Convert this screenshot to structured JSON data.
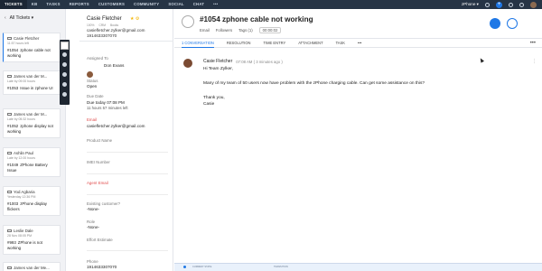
{
  "nav": {
    "tabs": [
      "TICKETS",
      "KB",
      "TASKS",
      "REPORTS",
      "CUSTOMERS",
      "COMMUNITY",
      "SOCIAL",
      "CHAT",
      "•••"
    ],
    "department": "zPhone ▾"
  },
  "list": {
    "view_label": "All Tickets ▾",
    "cards": [
      {
        "name": "Casie Fletcher",
        "meta": "11:57 hours left",
        "number": "#1054",
        "subject": "zphone cable not working"
      },
      {
        "name": "James van der M...",
        "meta": "Late by 09:00 hours",
        "number": "#1053",
        "subject": "Issue in zphone UI"
      },
      {
        "name": "James van der M...",
        "meta": "Late by 05:32 hours",
        "number": "#1052",
        "subject": "zphone display not working"
      },
      {
        "name": "Ashlin Paul",
        "meta": "Late by 12:00 hours",
        "number": "#1049",
        "subject": "ZPhone Battery Issue"
      },
      {
        "name": "Yod Agbaria",
        "meta": "Yesterday 12:36 PM",
        "number": "#1003",
        "subject": "zPhone display flickers"
      },
      {
        "name": "Leslie Dale",
        "meta": "28 Nov 08:05 PM",
        "number": "#993",
        "subject": "ZPhone is not working"
      },
      {
        "name": "James van der Me...",
        "meta": "",
        "number": "",
        "subject": ""
      }
    ]
  },
  "contact": {
    "name": "Casie Fletcher",
    "ratings": [
      "100%",
      "CRM",
      "Books"
    ],
    "email": "casiefletcher.zylker@gmail.com",
    "phone": "1914633307070",
    "fields": [
      {
        "label": "Assigned To",
        "value": "Don Evans"
      },
      {
        "label": "Status",
        "value": "Open"
      },
      {
        "label": "Due Date",
        "value": "Due today 07:08 PM"
      },
      {
        "label": "",
        "value": "11 hours 57 minutes left"
      },
      {
        "label": "Email",
        "value": "casiefletcher.zylker@gmail.com"
      },
      {
        "label": "Product Name",
        "value": ""
      },
      {
        "label": "IMEI Number",
        "value": ""
      },
      {
        "label": "Agent Email",
        "value": ""
      },
      {
        "label": "Existing customer?",
        "value": "-None-"
      },
      {
        "label": "Role",
        "value": "-None-"
      },
      {
        "label": "Effort Estimate",
        "value": ""
      },
      {
        "label": "Phone",
        "value": "1914633307070"
      }
    ]
  },
  "ticket": {
    "title": "#1054  zphone cable not working",
    "meta": [
      "Email",
      "Followers",
      "Tags (1)",
      "00:00:02"
    ],
    "tabs": [
      "1 CONVERSATION",
      "RESOLUTION",
      "TIME ENTRY",
      "ATTACHMENT",
      "TASK",
      "•••"
    ],
    "more": "•••"
  },
  "conversation": {
    "sender": "Casie Fletcher",
    "when": "07:08 AM ( 3 minutes ago )",
    "lines": [
      "Hi Team Zylker,",
      "Many of my team of 50 users now have problem with the zPhone charging cable. Can get some assistance on this?",
      "Thank you,",
      "Casie"
    ]
  },
  "status_bar": {
    "current_state_label": "CURRENT STATE",
    "transition_label": "TRANSITION"
  }
}
